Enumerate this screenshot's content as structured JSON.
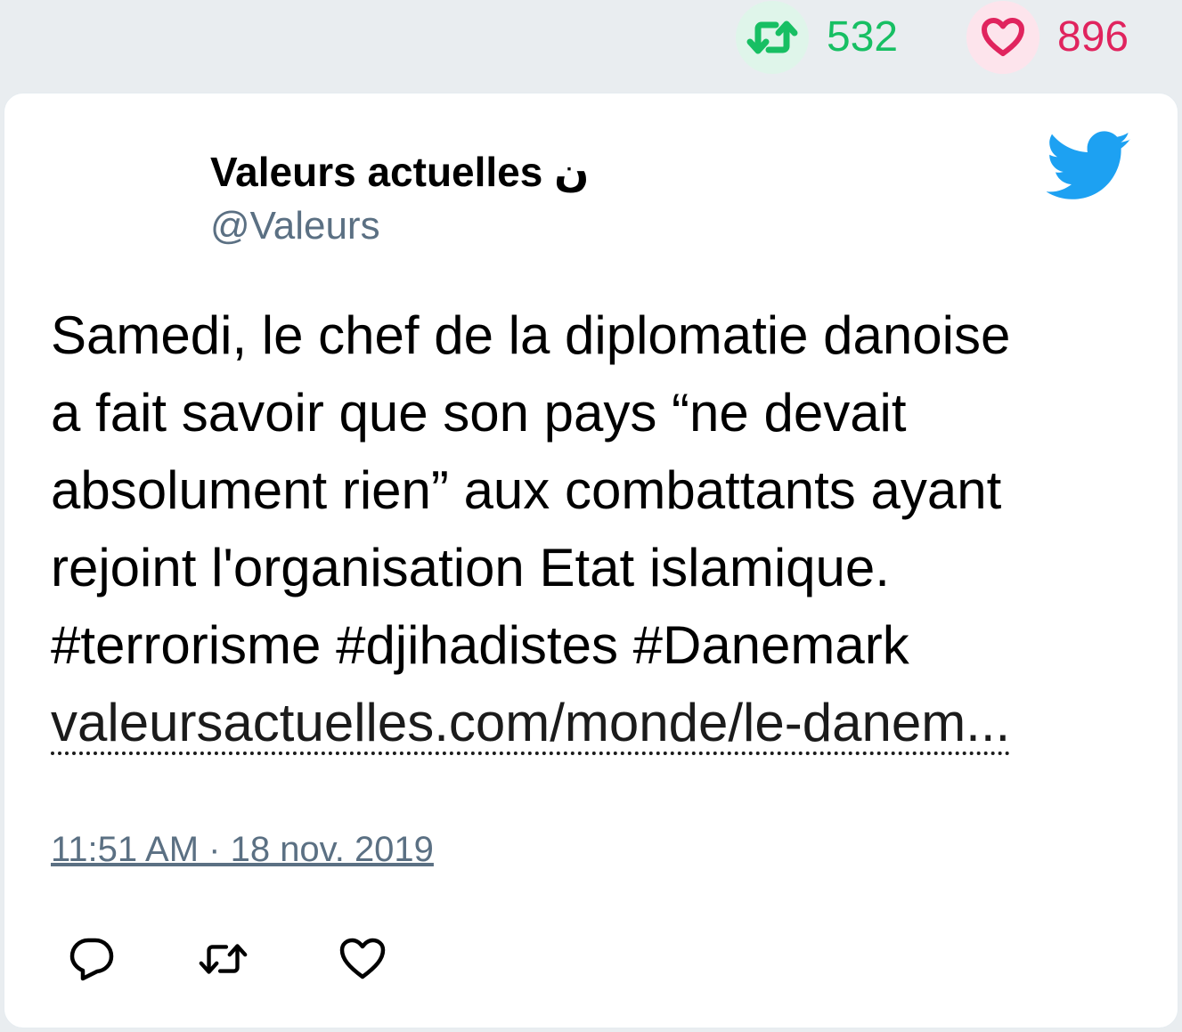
{
  "stats": {
    "retweets": {
      "count": "532",
      "icon": "retweet-icon",
      "color": "#17bf63"
    },
    "likes": {
      "count": "896",
      "icon": "heart-icon",
      "color": "#e0245e"
    }
  },
  "tweet": {
    "author_name": "Valeurs actuelles ن",
    "author_handle": "@Valeurs",
    "text_lines": [
      "Samedi, le chef de la diplomatie danoise",
      "a fait savoir que son pays “ne devait",
      "absolument rien” aux combattants ayant",
      "rejoint l'organisation Etat islamique.",
      "#terrorisme #djihadistes #Danemark"
    ],
    "link_text": "valeursactuelles.com/monde/le-danem...",
    "timestamp": "11:51 AM · 18 nov. 2019",
    "brand_icon": "twitter-bird-icon",
    "brand_color": "#1da1f2"
  },
  "actions": [
    {
      "name": "reply",
      "icon": "reply-icon"
    },
    {
      "name": "retweet",
      "icon": "retweet-icon"
    },
    {
      "name": "like",
      "icon": "heart-icon"
    }
  ]
}
